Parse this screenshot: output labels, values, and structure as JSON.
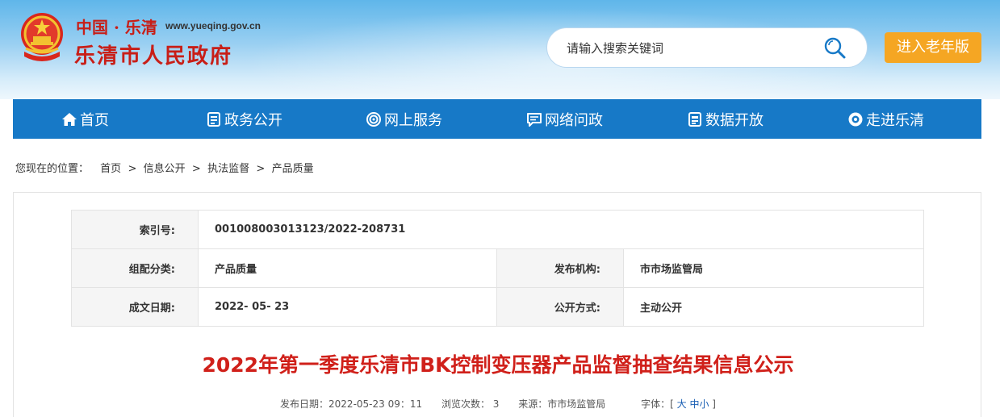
{
  "header": {
    "logo_cn": "中国 · 乐清",
    "logo_url": "www.yueqing.gov.cn",
    "logo_name": "乐清市人民政府",
    "search_placeholder": "请输入搜索关键词",
    "elder_mode_label": "进入老年版"
  },
  "nav": {
    "items": [
      {
        "label": "首页",
        "icon": "home-icon"
      },
      {
        "label": "政务公开",
        "icon": "document-icon"
      },
      {
        "label": "网上服务",
        "icon": "service-icon"
      },
      {
        "label": "网络问政",
        "icon": "message-icon"
      },
      {
        "label": "数据开放",
        "icon": "data-icon"
      },
      {
        "label": "走进乐清",
        "icon": "eye-icon"
      }
    ]
  },
  "breadcrumb": {
    "prefix": "您现在的位置：",
    "items": [
      "首页",
      "信息公开",
      "执法监督",
      "产品质量"
    ],
    "sep": " > "
  },
  "meta": {
    "index_label": "索引号:",
    "index_value": "001008003013123/2022-208731",
    "category_label": "组配分类:",
    "category_value": "产品质量",
    "publisher_label": "发布机构:",
    "publisher_value": "市市场监管局",
    "date_label": "成文日期:",
    "date_value": "2022- 05- 23",
    "open_label": "公开方式:",
    "open_value": "主动公开"
  },
  "article": {
    "title": "2022年第一季度乐清市BK控制变压器产品监督抽查结果信息公示",
    "publish_date": "发布日期：2022-05-23 09：11",
    "views": "浏览次数： 3",
    "source": "来源：市市场监管局",
    "font_label": "字体：",
    "font_open": "[ ",
    "font_large": "大",
    "font_medium": "中",
    "font_small": "小",
    "font_close": " ]"
  },
  "colors": {
    "nav_bg": "#1779c7",
    "title_red": "#d0201a",
    "elder_orange": "#f5a623",
    "logo_red": "#c81e17"
  }
}
